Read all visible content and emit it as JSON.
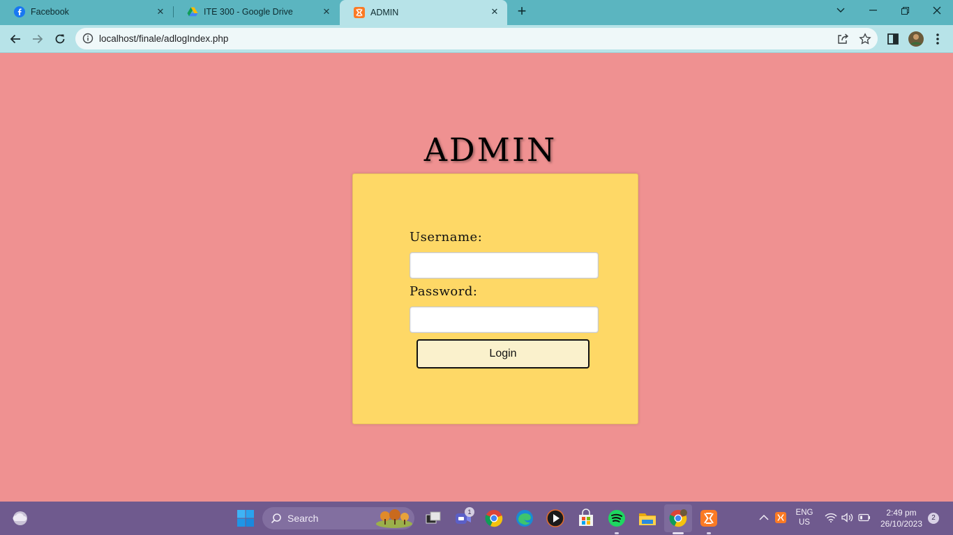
{
  "browser": {
    "tabs": [
      {
        "title": "Facebook",
        "icon": "facebook-icon",
        "active": false
      },
      {
        "title": "ITE 300 - Google Drive",
        "icon": "google-drive-icon",
        "active": false
      },
      {
        "title": "ADMIN",
        "icon": "xampp-icon",
        "active": true
      }
    ],
    "url": "localhost/finale/adlogIndex.php"
  },
  "page": {
    "title": "ADMIN",
    "username_label": "Username:",
    "username_value": "",
    "password_label": "Password:",
    "password_value": "",
    "login_label": "Login"
  },
  "colors": {
    "page_bg": "#ef9191",
    "card_bg": "#fed866",
    "button_bg": "#faf1cc",
    "browser_frame": "#5bb5c0",
    "taskbar": "#6f5a8e"
  },
  "taskbar": {
    "search_label": "Search",
    "teams_badge": "1",
    "language_line1": "ENG",
    "language_line2": "US",
    "time": "2:49 pm",
    "date": "26/10/2023",
    "notification_count": "2"
  }
}
